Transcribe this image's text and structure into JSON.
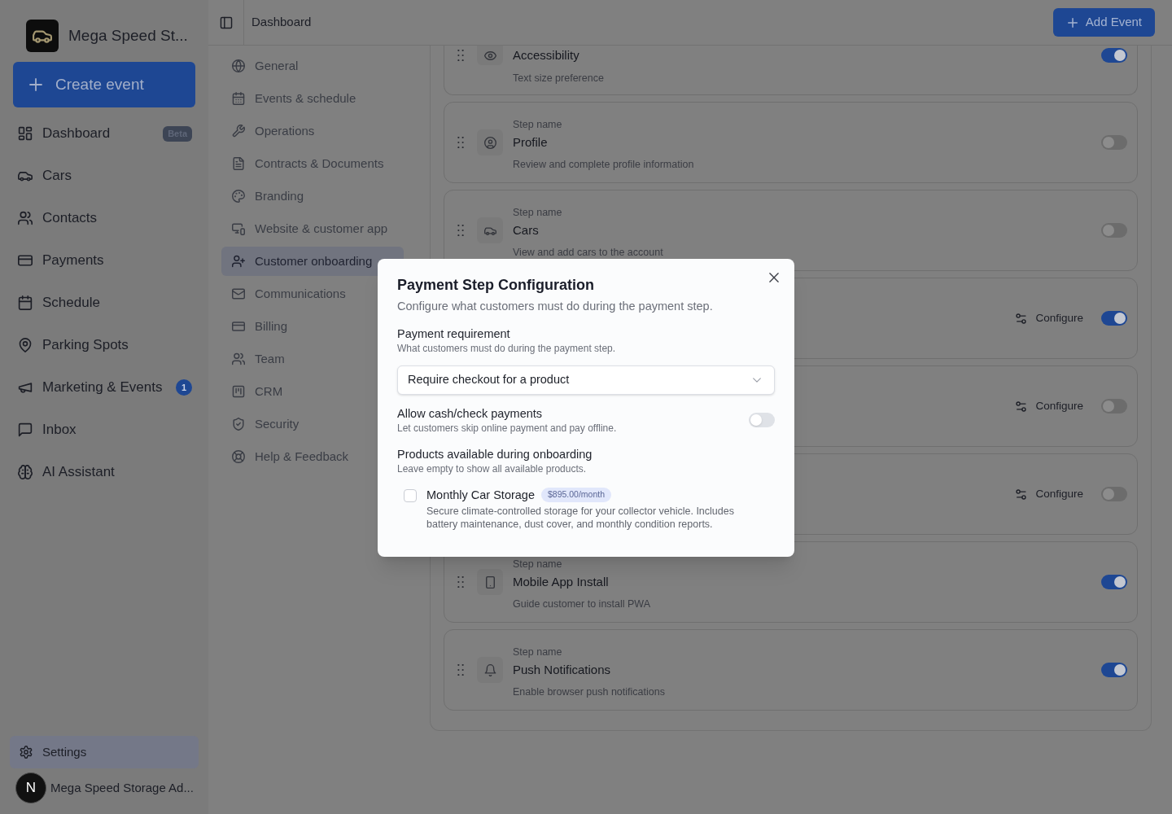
{
  "sidebar": {
    "brand": "Mega Speed St...",
    "create_button": "Create event",
    "items": [
      {
        "label": "Dashboard",
        "badge": "Beta",
        "selected": false
      },
      {
        "label": "Cars",
        "selected": false
      },
      {
        "label": "Contacts",
        "selected": false
      },
      {
        "label": "Payments",
        "selected": false
      },
      {
        "label": "Schedule",
        "selected": false
      },
      {
        "label": "Parking Spots",
        "selected": false
      },
      {
        "label": "Marketing & Events",
        "count": "1",
        "selected": false
      },
      {
        "label": "Inbox",
        "selected": false
      },
      {
        "label": "AI Assistant",
        "selected": false
      }
    ],
    "footer": {
      "settings": {
        "label": "Settings",
        "selected": true
      },
      "round_button": "N",
      "account": "Mega Speed Storage Ad..."
    }
  },
  "topbar": {
    "breadcrumb": "Dashboard",
    "add_button": "Add Event"
  },
  "settings_nav": [
    {
      "label": "General",
      "selected": false
    },
    {
      "label": "Events & schedule",
      "selected": false
    },
    {
      "label": "Operations",
      "selected": false
    },
    {
      "label": "Contracts & Documents",
      "selected": false
    },
    {
      "label": "Branding",
      "selected": false
    },
    {
      "label": "Website & customer app",
      "selected": false
    },
    {
      "label": "Customer onboarding",
      "selected": true
    },
    {
      "label": "Communications",
      "selected": false
    },
    {
      "label": "Billing",
      "selected": false
    },
    {
      "label": "Team",
      "selected": false
    },
    {
      "label": "CRM",
      "selected": false
    },
    {
      "label": "Security",
      "selected": false
    },
    {
      "label": "Help & Feedback",
      "selected": false
    }
  ],
  "steps": [
    {
      "name": "Accessibility",
      "description": "Text size preference",
      "on": true
    },
    {
      "label": "Step name",
      "name": "Profile",
      "description": "Review and complete profile information",
      "on": false
    },
    {
      "label": "Step name",
      "name": "Cars",
      "description": "View and add cars to the account",
      "on": false
    },
    {
      "configure": "Configure",
      "on": true
    },
    {
      "configure": "Configure",
      "on": false
    },
    {
      "configure": "Configure",
      "on": false
    },
    {
      "label": "Step name",
      "name": "Mobile App Install",
      "description": "Guide customer to install PWA",
      "on": true
    },
    {
      "label": "Step name",
      "name": "Push Notifications",
      "description": "Enable browser push notifications",
      "on": true
    }
  ],
  "modal": {
    "title": "Payment Step Configuration",
    "subtitle": "Configure what customers must do during the payment step.",
    "payment_requirement": {
      "label": "Payment requirement",
      "help": "What customers must do during the payment step.",
      "value": "Require checkout for a product"
    },
    "cash_payments": {
      "label": "Allow cash/check payments",
      "help": "Let customers skip online payment and pay offline.",
      "on": false
    },
    "products": {
      "label": "Products available during onboarding",
      "help": "Leave empty to show all available products.",
      "items": [
        {
          "name": "Monthly Car Storage",
          "price": "$895.00/month",
          "description": "Secure climate-controlled storage for your collector vehicle. Includes battery maintenance, dust cover, and monthly condition reports.",
          "checked": false
        }
      ]
    }
  }
}
